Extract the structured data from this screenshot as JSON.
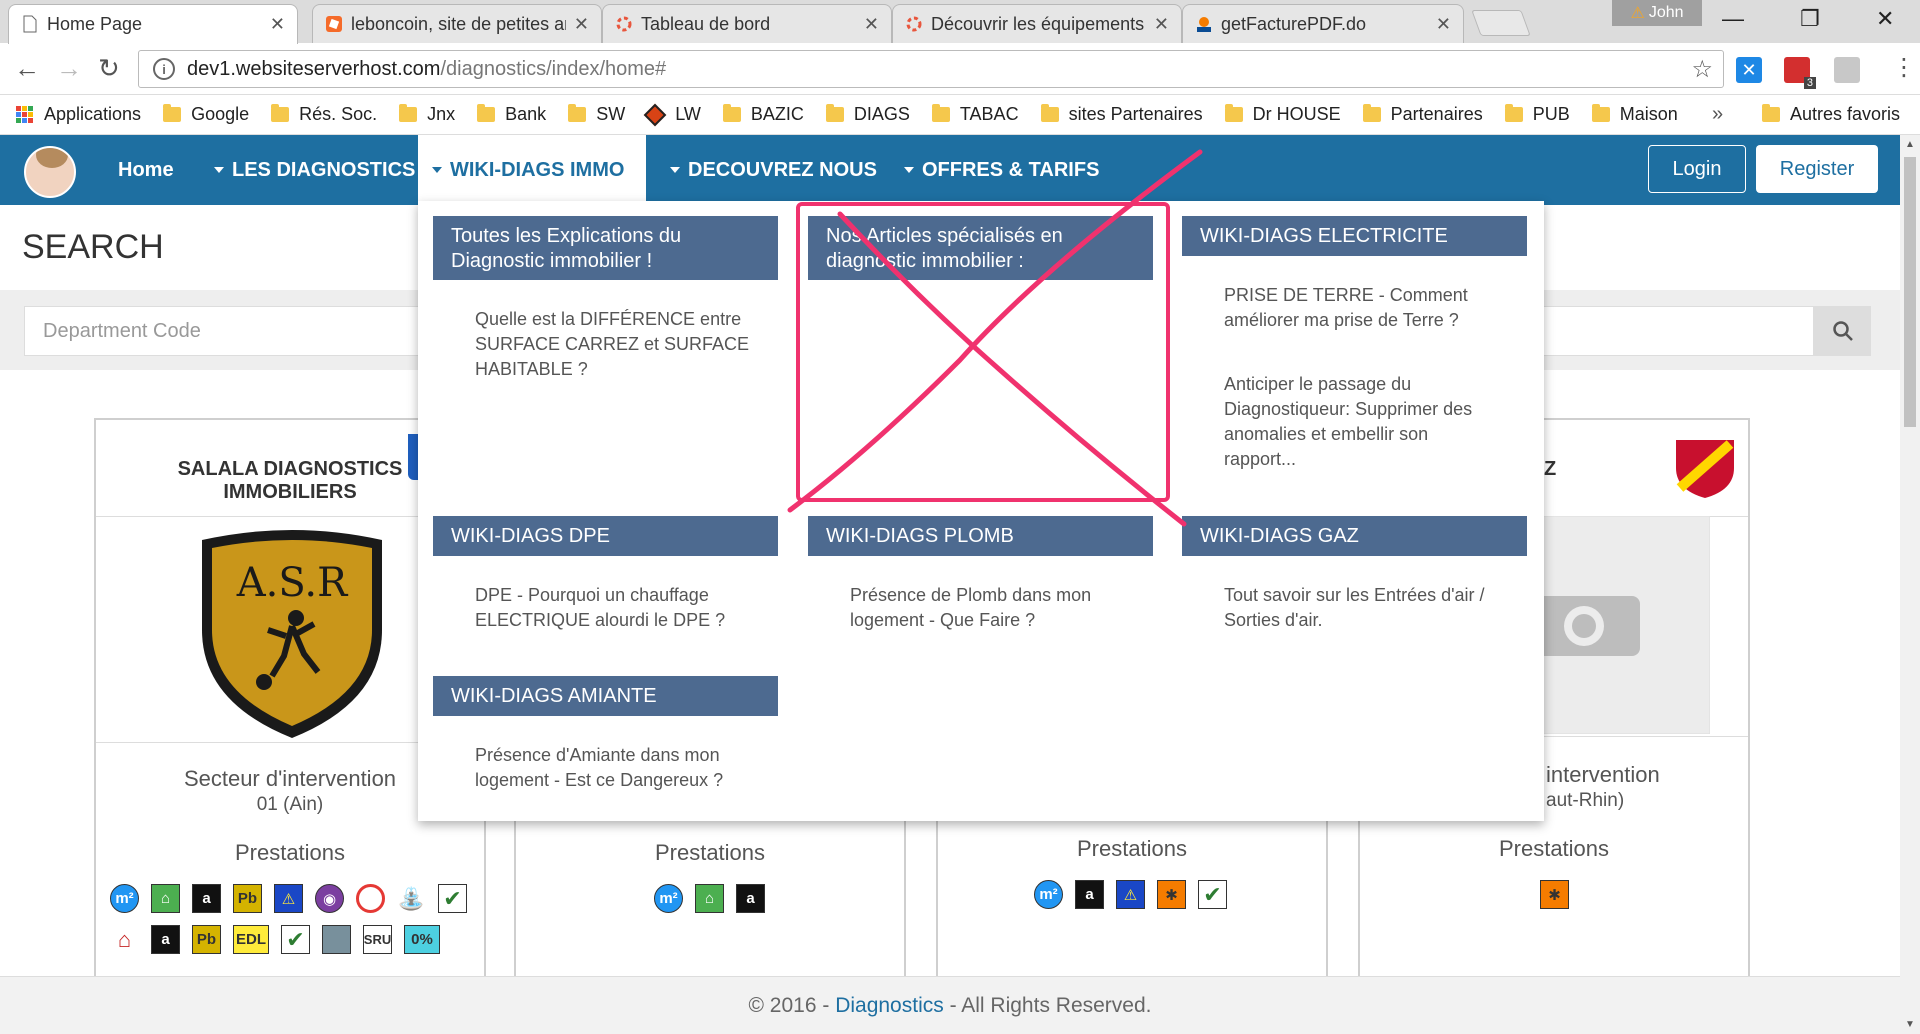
{
  "browser": {
    "tabs": [
      {
        "title": "Home Page",
        "close": "✕"
      },
      {
        "title": "leboncoin, site de petites annonces",
        "close": "✕"
      },
      {
        "title": "Tableau de bord",
        "close": "✕"
      },
      {
        "title": "Découvrir les équipements",
        "close": "✕"
      },
      {
        "title": "getFacturePDF.do",
        "close": "✕"
      }
    ],
    "profile": "John",
    "url_host": "dev1.websiteserverhost.com",
    "url_path": "/diagnostics/index/home#",
    "ext_badge": "3",
    "bookmarks": [
      "Applications",
      "Google",
      "Rés. Soc.",
      "Jnx",
      "Bank",
      "SW",
      "LW",
      "BAZIC",
      "DIAGS",
      "TABAC",
      "sites Partenaires",
      "Dr HOUSE",
      "Partenaires",
      "PUB",
      "Maison"
    ],
    "bookmarks_more": "»",
    "other_bookmarks": "Autres favoris"
  },
  "nav": {
    "home": "Home",
    "items": [
      "LES DIAGNOSTICS",
      "WIKI-DIAGS IMMO",
      "DECOUVREZ NOUS",
      "OFFRES & TARIFS"
    ],
    "login": "Login",
    "register": "Register",
    "accent_color": "#1e6fa1"
  },
  "search": {
    "title": "SEARCH",
    "department_placeholder": "Department Code"
  },
  "menu": {
    "sections": [
      {
        "title": "Toutes les Explications du Diagnostic immobilier !",
        "links": [
          "Quelle est la DIFFÉRENCE entre SURFACE CARREZ et SURFACE HABITABLE ?"
        ]
      },
      {
        "title": "Nos Articles spécialisés en diagnostic immobilier :",
        "links": []
      },
      {
        "title": "WIKI-DIAGS ELECTRICITE",
        "links": [
          "PRISE DE TERRE - Comment améliorer ma prise de Terre ?",
          "Anticiper le passage du Diagnostiqueur: Supprimer des anomalies et embellir son rapport..."
        ]
      },
      {
        "title": "WIKI-DIAGS DPE",
        "links": [
          "DPE - Pourquoi un chauffage ELECTRIQUE alourdi le DPE ?"
        ]
      },
      {
        "title": "WIKI-DIAGS PLOMB",
        "links": [
          "Présence de Plomb dans mon logement - Que Faire ?"
        ]
      },
      {
        "title": "WIKI-DIAGS GAZ",
        "links": [
          "Tout savoir sur les Entrées d'air / Sorties d'air."
        ]
      },
      {
        "title": "WIKI-DIAGS AMIANTE",
        "links": [
          "Présence d'Amiante dans mon logement - Est ce Dangereux ?"
        ]
      }
    ],
    "header_color": "#4d6a90"
  },
  "cards": [
    {
      "title": "SALALA DIAGNOSTICS IMMOBILIERS",
      "logo_text": "A.S.R",
      "secteur": "Secteur d'intervention",
      "dept": "01 (Ain)",
      "prestations": "Prestations"
    },
    {
      "prestations": "Prestations"
    },
    {
      "prestations": "Prestations"
    },
    {
      "title_tail": "Z",
      "secteur": "intervention",
      "dept": "aut-Rhin)",
      "prestations": "Prestations"
    }
  ],
  "prestation_icons": {
    "m2": "m²",
    "amiante": "a",
    "plomb": "Pb",
    "edl": "EDL",
    "sru": "SRU",
    "zero": "0%"
  },
  "footer": {
    "prefix": "© 2016 - ",
    "link": "Diagnostics",
    "suffix": " - All Rights Reserved."
  },
  "annotation_color": "#f0326e"
}
